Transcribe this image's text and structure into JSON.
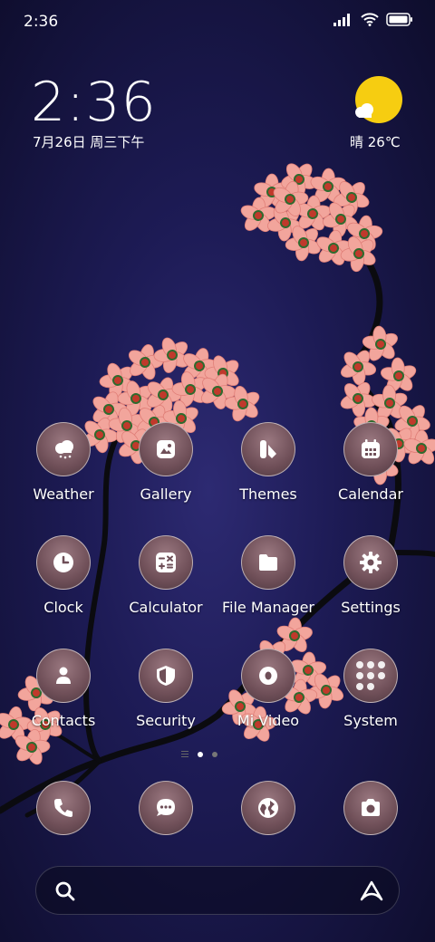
{
  "status_bar": {
    "time": "2:36"
  },
  "clock_widget": {
    "time": "2:36",
    "date": "7月26日 周三下午"
  },
  "weather_widget": {
    "text": "晴 26℃",
    "sun_color": "#f6cd11"
  },
  "apps": [
    {
      "label": "Weather",
      "icon": "weather-icon"
    },
    {
      "label": "Gallery",
      "icon": "gallery-icon"
    },
    {
      "label": "Themes",
      "icon": "themes-icon"
    },
    {
      "label": "Calendar",
      "icon": "calendar-icon"
    },
    {
      "label": "Clock",
      "icon": "clock-icon"
    },
    {
      "label": "Calculator",
      "icon": "calculator-icon"
    },
    {
      "label": "File Manager",
      "icon": "folder-icon"
    },
    {
      "label": "Settings",
      "icon": "gear-icon"
    },
    {
      "label": "Contacts",
      "icon": "contacts-icon"
    },
    {
      "label": "Security",
      "icon": "shield-icon"
    },
    {
      "label": "Mi Video",
      "icon": "video-icon"
    },
    {
      "label": "System",
      "icon": "folder-grid-icon"
    }
  ],
  "dock": [
    {
      "icon": "phone-icon"
    },
    {
      "icon": "message-icon"
    },
    {
      "icon": "browser-icon"
    },
    {
      "icon": "camera-icon"
    }
  ],
  "page_indicator": {
    "current": 1,
    "total": 2
  },
  "theme": {
    "blossom": "#f2a59c",
    "blossom_dark": "#e07f78",
    "branch": "#0b0b0f"
  }
}
